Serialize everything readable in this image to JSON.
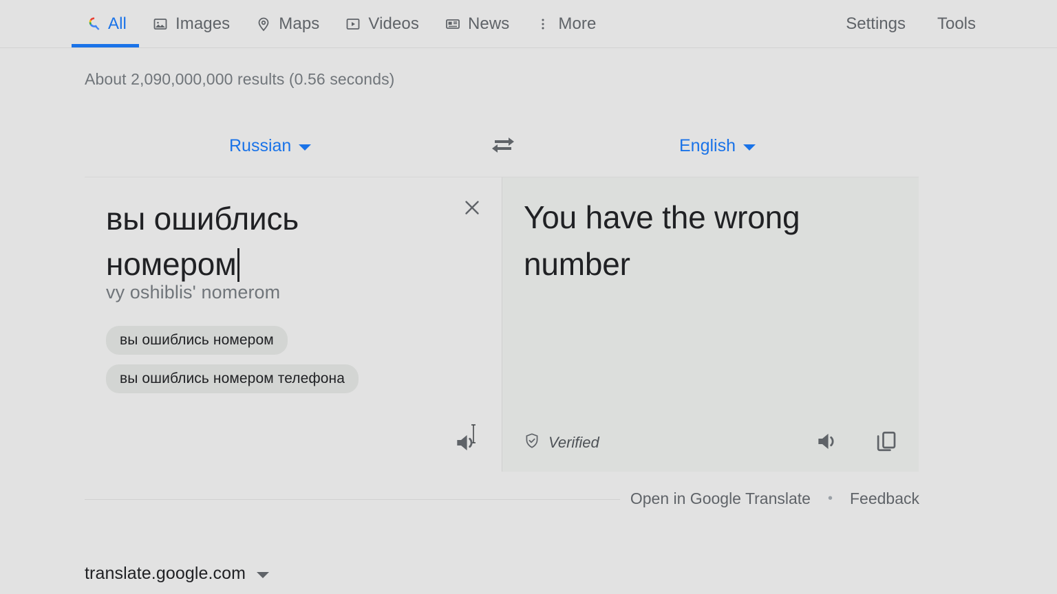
{
  "nav": {
    "tabs": [
      {
        "label": "All",
        "icon": "google-search-icon",
        "active": true
      },
      {
        "label": "Images",
        "icon": "image-icon",
        "active": false
      },
      {
        "label": "Maps",
        "icon": "map-pin-icon",
        "active": false
      },
      {
        "label": "Videos",
        "icon": "video-icon",
        "active": false
      },
      {
        "label": "News",
        "icon": "news-icon",
        "active": false
      },
      {
        "label": "More",
        "icon": "more-vertical-icon",
        "active": false
      }
    ],
    "settings_label": "Settings",
    "tools_label": "Tools",
    "accent_color": "#1a73e8"
  },
  "result_stats": "About 2,090,000,000 results (0.56 seconds)",
  "translate": {
    "source_language": "Russian",
    "target_language": "English",
    "swap_icon": "swap-horizontal-icon",
    "source_text": "вы ошиблись номером",
    "transliteration": "vy oshiblis' nomerom",
    "suggestions": [
      "вы ошиблись номером",
      "вы ошиблись номером телефона"
    ],
    "translated_text": "You have the wrong number",
    "verified_label": "Verified",
    "verified_icon": "shield-check-icon",
    "clear_icon": "close-icon",
    "listen_source_icon": "speaker-icon",
    "listen_target_icon": "speaker-icon",
    "copy_icon": "copy-icon"
  },
  "footer": {
    "open_in_translate": "Open in Google Translate",
    "separator": "•",
    "feedback": "Feedback",
    "source_domain": "translate.google.com"
  }
}
